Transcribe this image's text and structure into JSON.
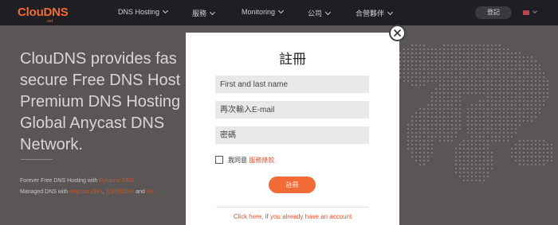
{
  "navbar": {
    "logo_text": "ClouDNS",
    "logo_sub": ".net",
    "items": [
      {
        "label": "DNS Hosting"
      },
      {
        "label": "服務"
      },
      {
        "label": "Monitoring"
      },
      {
        "label": "公司"
      },
      {
        "label": "合營夥伴"
      }
    ],
    "login_label": "登記"
  },
  "hero": {
    "title_lines": [
      "ClouDNS provides fas",
      "secure Free DNS Host",
      "Premium DNS Hosting",
      "Global Anycast DNS",
      "Network."
    ],
    "desc_line1_prefix": "Forever Free DNS Hosting with ",
    "desc_line1_link": "Dynamic DNS",
    "desc_line2_prefix": "Managed DNS with ",
    "desc_line2_link1": "Anycast DNS",
    "desc_line2_sep": ", ",
    "desc_line2_link2": "反向的DNS",
    "desc_line2_and": " and ",
    "desc_line2_link3": "Ge"
  },
  "modal": {
    "title": "註冊",
    "name_placeholder": "First and last name",
    "email_placeholder": "再次輸入E-mail",
    "password_placeholder": "密碼",
    "agree_text": "我同意 ",
    "terms_link": "服務條款.",
    "register_label": "註冊",
    "login_link": "Click here, if you already have an account"
  },
  "colors": {
    "accent": "#f26a35",
    "link": "#e8502c",
    "navbar_bg": "#1f1f23",
    "overlay_bg": "#5a5656"
  }
}
